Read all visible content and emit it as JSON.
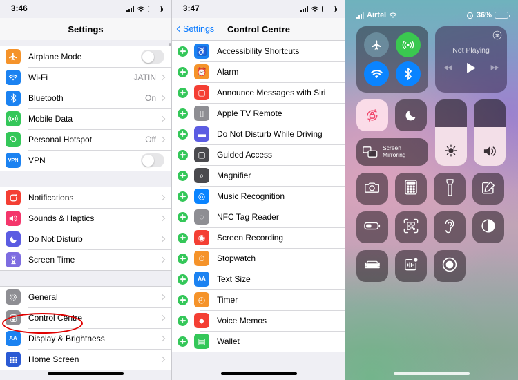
{
  "panel1": {
    "status": {
      "time": "3:46"
    },
    "nav": {
      "title": "Settings"
    },
    "groups": [
      {
        "rows": [
          {
            "label": "Airplane Mode",
            "icon": "airplane-icon",
            "color": "#f5932a",
            "control": "toggle",
            "value": ""
          },
          {
            "label": "Wi-Fi",
            "icon": "wifi-icon",
            "color": "#1b82f1",
            "control": "chevron",
            "value": "JATIN"
          },
          {
            "label": "Bluetooth",
            "icon": "bluetooth-icon",
            "color": "#1b82f1",
            "control": "chevron",
            "value": "On"
          },
          {
            "label": "Mobile Data",
            "icon": "cellular-icon",
            "color": "#34c759",
            "control": "chevron",
            "value": ""
          },
          {
            "label": "Personal Hotspot",
            "icon": "hotspot-icon",
            "color": "#34c759",
            "control": "chevron",
            "value": "Off"
          },
          {
            "label": "VPN",
            "icon": "vpn-icon",
            "color": "#1b82f1",
            "control": "toggle",
            "value": ""
          }
        ]
      },
      {
        "rows": [
          {
            "label": "Notifications",
            "icon": "notifications-icon",
            "color": "#f43f34",
            "control": "chevron",
            "value": ""
          },
          {
            "label": "Sounds & Haptics",
            "icon": "sounds-icon",
            "color": "#f4366b",
            "control": "chevron",
            "value": ""
          },
          {
            "label": "Do Not Disturb",
            "icon": "moon-icon",
            "color": "#5b5ce2",
            "control": "chevron",
            "value": ""
          },
          {
            "label": "Screen Time",
            "icon": "hourglass-icon",
            "color": "#7d6ce0",
            "control": "chevron",
            "value": ""
          }
        ]
      },
      {
        "rows": [
          {
            "label": "General",
            "icon": "gear-icon",
            "color": "#8e8e93",
            "control": "chevron",
            "value": ""
          },
          {
            "label": "Control Centre",
            "icon": "control-centre-icon",
            "color": "#8e8e93",
            "control": "chevron",
            "value": ""
          },
          {
            "label": "Display & Brightness",
            "icon": "text-size-icon",
            "color": "#1b82f1",
            "control": "chevron",
            "value": ""
          },
          {
            "label": "Home Screen",
            "icon": "home-screen-icon",
            "color": "#2b5ad4",
            "control": "chevron",
            "value": ""
          }
        ]
      }
    ],
    "highlight": "Control Centre"
  },
  "panel2": {
    "status": {
      "time": "3:47"
    },
    "nav": {
      "back_label": "Settings",
      "title": "Control Centre"
    },
    "rows": [
      {
        "label": "Accessibility Shortcuts",
        "icon": "accessibility-icon",
        "color": "#1b82f1",
        "glyph": "♿"
      },
      {
        "label": "Alarm",
        "icon": "alarm-icon",
        "color": "#f5932a",
        "glyph": "⏰"
      },
      {
        "label": "Announce Messages with Siri",
        "icon": "messages-icon",
        "color": "#f43f34",
        "glyph": "▢"
      },
      {
        "label": "Apple TV Remote",
        "icon": "tv-remote-icon",
        "color": "#8e8e93",
        "glyph": "▯"
      },
      {
        "label": "Do Not Disturb While Driving",
        "icon": "car-icon",
        "color": "#5b5ce2",
        "glyph": "▬"
      },
      {
        "label": "Guided Access",
        "icon": "guided-access-icon",
        "color": "#4a4a4e",
        "glyph": "▢"
      },
      {
        "label": "Magnifier",
        "icon": "magnifier-icon",
        "color": "#4a4a4e",
        "glyph": "⌕"
      },
      {
        "label": "Music Recognition",
        "icon": "shazam-icon",
        "color": "#0a84ff",
        "glyph": "◎"
      },
      {
        "label": "NFC Tag Reader",
        "icon": "nfc-icon",
        "color": "#8e8e93",
        "glyph": "◌"
      },
      {
        "label": "Screen Recording",
        "icon": "screen-recording-icon",
        "color": "#f43f34",
        "glyph": "◉"
      },
      {
        "label": "Stopwatch",
        "icon": "stopwatch-icon",
        "color": "#f5932a",
        "glyph": "⏱"
      },
      {
        "label": "Text Size",
        "icon": "text-size-icon",
        "color": "#1b82f1",
        "glyph": "AA"
      },
      {
        "label": "Timer",
        "icon": "timer-icon",
        "color": "#f5932a",
        "glyph": "◴"
      },
      {
        "label": "Voice Memos",
        "icon": "voice-memos-icon",
        "color": "#f43f34",
        "glyph": "⬥"
      },
      {
        "label": "Wallet",
        "icon": "wallet-icon",
        "color": "#34c759",
        "glyph": "▤"
      }
    ],
    "highlight": "Screen Recording",
    "add_label": "Add"
  },
  "panel3": {
    "status": {
      "carrier": "Airtel",
      "battery_pct": "36%",
      "lock_icon": "rotation-lock-status-icon"
    },
    "connectivity": {
      "airplane": {
        "name": "airplane-mode-toggle",
        "state": "off"
      },
      "cellular": {
        "name": "cellular-data-toggle",
        "state": "on"
      },
      "wifi": {
        "name": "wifi-toggle",
        "state": "on"
      },
      "bluetooth": {
        "name": "bluetooth-toggle",
        "state": "on"
      }
    },
    "media": {
      "title": "Not Playing",
      "prev": "previous-track-button",
      "play": "play-button",
      "next": "next-track-button",
      "airplay": "airplay-icon"
    },
    "rotation_lock": {
      "name": "rotation-lock-toggle",
      "state": "on"
    },
    "do_not_disturb": {
      "name": "do-not-disturb-toggle",
      "state": "off"
    },
    "screen_mirroring": {
      "label": "Screen\nMirroring",
      "line1": "Screen",
      "line2": "Mirroring"
    },
    "brightness": {
      "name": "brightness-slider",
      "level": 58
    },
    "volume": {
      "name": "volume-slider",
      "level": 58
    },
    "grid": [
      {
        "name": "camera-button",
        "icon": "camera-icon"
      },
      {
        "name": "calculator-button",
        "icon": "calculator-icon"
      },
      {
        "name": "flashlight-button",
        "icon": "flashlight-icon"
      },
      {
        "name": "notes-button",
        "icon": "notes-icon"
      },
      {
        "name": "low-power-mode-button",
        "icon": "battery-icon"
      },
      {
        "name": "code-scanner-button",
        "icon": "qr-scanner-icon"
      },
      {
        "name": "hearing-button",
        "icon": "ear-icon"
      },
      {
        "name": "dark-mode-button",
        "icon": "dark-mode-icon"
      },
      {
        "name": "sleep-mode-button",
        "icon": "bed-icon"
      },
      {
        "name": "sound-recognition-button",
        "icon": "sound-recognition-icon"
      },
      {
        "name": "screen-recording-button",
        "icon": "record-icon"
      }
    ],
    "annotation": {
      "arrow": "red-arrow-pointer",
      "color": "#e00000"
    }
  }
}
